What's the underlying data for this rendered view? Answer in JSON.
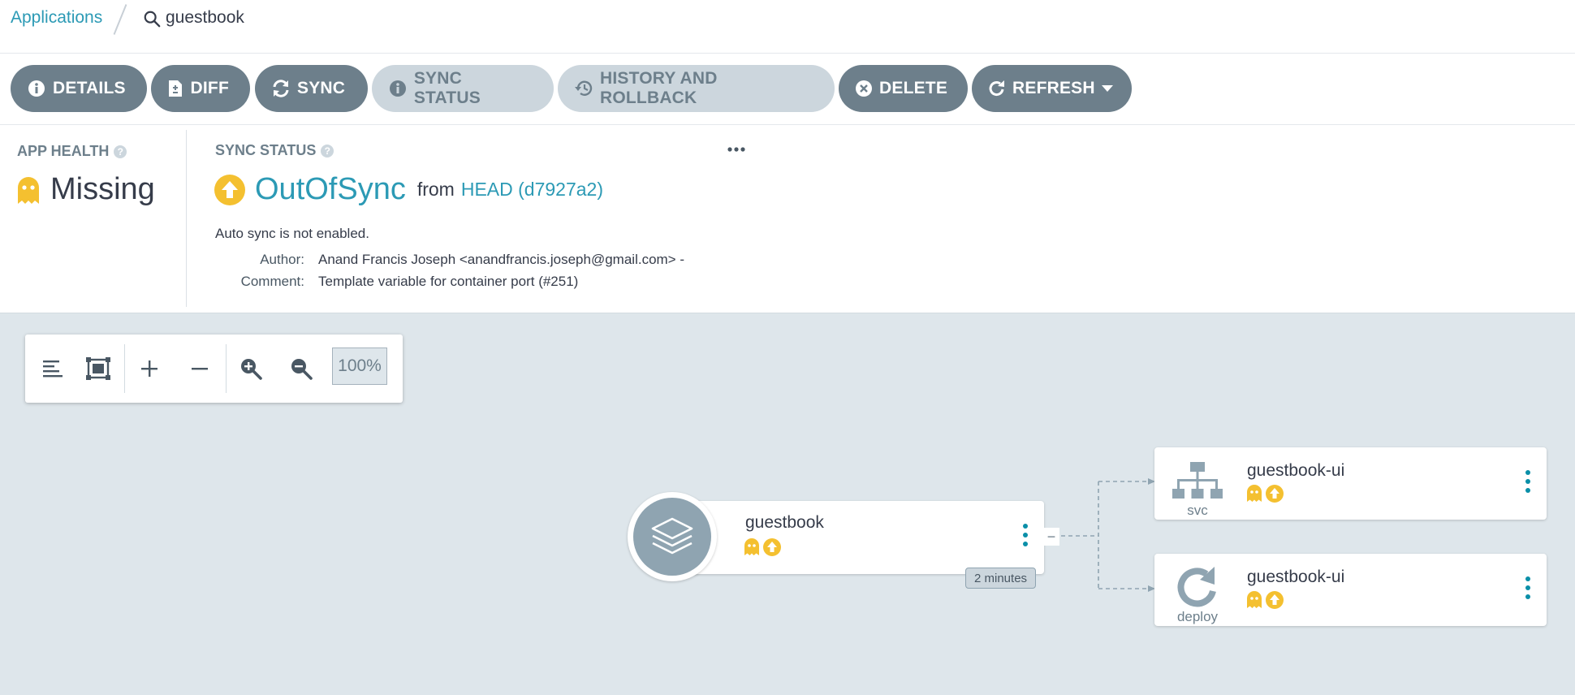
{
  "breadcrumb": {
    "applications": "Applications",
    "app_name": "guestbook"
  },
  "toolbar": {
    "details": "DETAILS",
    "diff": "DIFF",
    "sync": "SYNC",
    "sync_status": "SYNC STATUS",
    "history": "HISTORY AND ROLLBACK",
    "delete": "DELETE",
    "refresh": "REFRESH"
  },
  "status": {
    "app_health_label": "APP HEALTH",
    "app_health_value": "Missing",
    "sync_status_label": "SYNC STATUS",
    "sync_status_value": "OutOfSync",
    "from_label": "from",
    "revision": "HEAD (d7927a2)",
    "auto_sync": "Auto sync is not enabled.",
    "author_label": "Author:",
    "author_value": "Anand Francis Joseph <anandfrancis.joseph@gmail.com> -",
    "comment_label": "Comment:",
    "comment_value": "Template variable for container port (#251)"
  },
  "zoom": {
    "level": "100%"
  },
  "graph": {
    "root": {
      "name": "guestbook",
      "age": "2 minutes"
    },
    "children": [
      {
        "name": "guestbook-ui",
        "kind": "svc"
      },
      {
        "name": "guestbook-ui",
        "kind": "deploy"
      }
    ]
  },
  "colors": {
    "accent": "#2c9ab5",
    "warning": "#f4c030",
    "button": "#6d7f8b",
    "canvas": "#dee6eb"
  }
}
